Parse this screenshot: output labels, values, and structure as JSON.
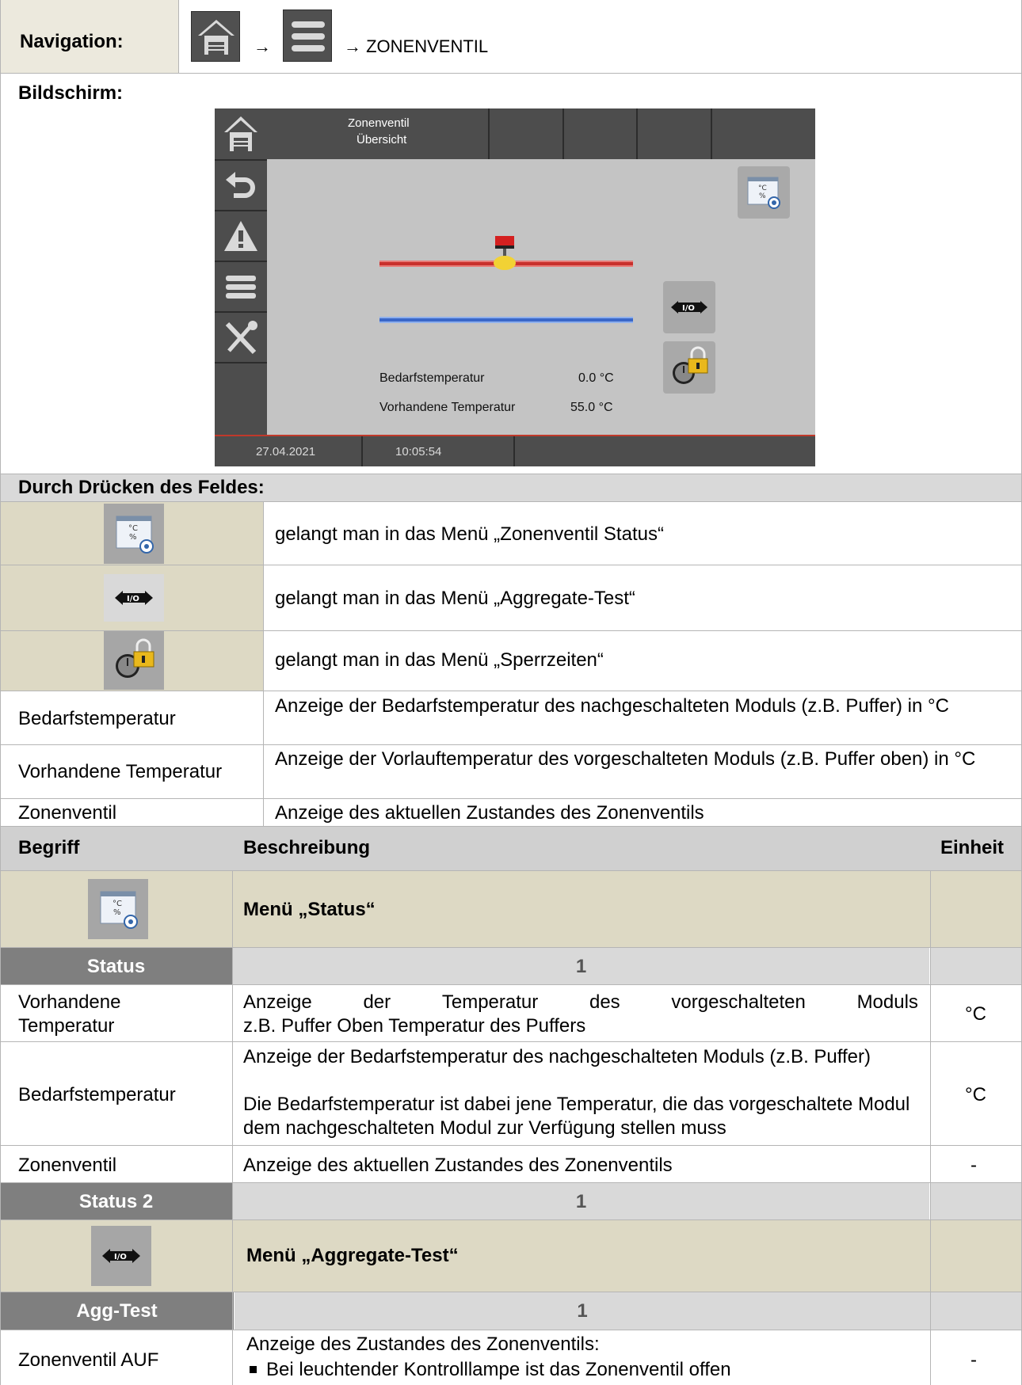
{
  "navigation": {
    "label": "Navigation:",
    "arrow1": "→",
    "path_text": "→ ZONENVENTIL"
  },
  "screen_section": {
    "label": "Bildschirm:"
  },
  "screen": {
    "title_line1": "Zonenventil",
    "title_line2": "Übersicht",
    "bedarf_label": "Bedarfstemperatur",
    "bedarf_value": "0.0 °C",
    "vorhanden_label": "Vorhandene Temperatur",
    "vorhanden_value": "55.0 °C",
    "date": "27.04.2021",
    "time": "10:05:54",
    "valve_label": "I/O"
  },
  "press_section": {
    "label": "Durch Drücken des Feldes:",
    "rows": [
      {
        "icon": "status-icon",
        "text": "gelangt man in das Menü „Zonenventil Status“"
      },
      {
        "icon": "io-icon",
        "text": "gelangt man in das Menü „Aggregate-Test“"
      },
      {
        "icon": "lock-clock-icon",
        "text": "gelangt man in das Menü „Sperrzeiten“"
      },
      {
        "term": "Bedarfstemperatur",
        "text": "Anzeige der Bedarfstemperatur des nachgeschalteten Moduls (z.B. Puffer) in °C"
      },
      {
        "term": "Vorhandene Temperatur",
        "text": "Anzeige der Vorlauftemperatur des vorgeschalteten Moduls (z.B. Puffer oben) in °C"
      },
      {
        "term": "Zonenventil",
        "text": "Anzeige des aktuellen Zustandes des Zonenventils"
      }
    ]
  },
  "table": {
    "headers": {
      "term": "Begriff",
      "desc": "Beschreibung",
      "unit": "Einheit"
    },
    "menu_status": "Menü „Status“",
    "status_label": "Status",
    "status_num": "1",
    "rows_status": [
      {
        "term": "Vorhandene Temperatur",
        "desc1": "Anzeige der Temperatur des vorgeschalteten Moduls",
        "desc2": "z.B. Puffer Oben Temperatur des Puffers",
        "unit": "°C"
      },
      {
        "term": "Bedarfstemperatur",
        "desc": "Anzeige der Bedarfstemperatur des nachgeschalteten Moduls (z.B. Puffer)",
        "desc_b": "Die Bedarfstemperatur ist dabei jene Temperatur, die das vorgeschaltete Modul dem nachgeschalteten Modul zur Verfügung stellen muss",
        "unit": "°C"
      },
      {
        "term": "Zonenventil",
        "desc": "Anzeige des aktuellen Zustandes des Zonenventils",
        "unit": "-"
      }
    ],
    "status2_label": "Status 2",
    "status2_num": "1",
    "menu_agg": "Menü „Aggregate-Test“",
    "agg_label": "Agg-Test",
    "agg_num": "1",
    "rows_agg": [
      {
        "term": "Zonenventil AUF",
        "desc": "Anzeige des Zustandes des Zonenventils:",
        "bullet": "Bei leuchtender Kontrolllampe ist das Zonenventil offen",
        "unit": "-"
      }
    ]
  },
  "colors": {
    "beige": "#ddd9c4",
    "dark_header": "#7f7f7f",
    "light_header": "#d9d9d9",
    "pipe_red": "#d0312d",
    "pipe_blue": "#3b6fd1"
  }
}
